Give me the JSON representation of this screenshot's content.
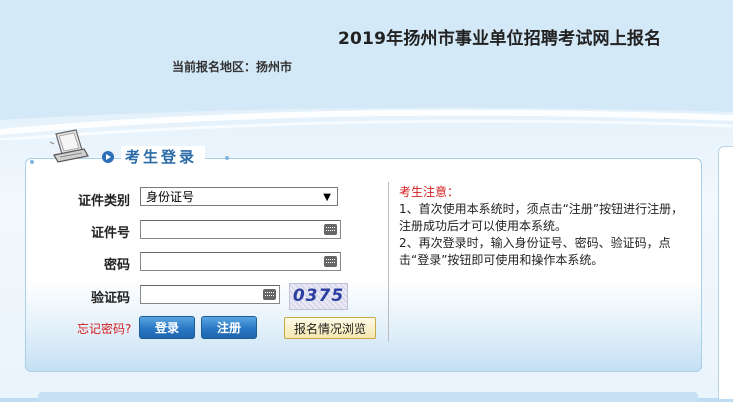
{
  "header": {
    "title": "2019年扬州市事业单位招聘考试网上报名",
    "region_label": "当前报名地区：扬州市"
  },
  "login": {
    "legend": "考生登录",
    "cert_type_label": "证件类别",
    "cert_type_value": "身份证号",
    "cert_no_label": "证件号",
    "password_label": "密码",
    "captcha_label": "验证码",
    "captcha_text": "0375",
    "forgot_label": "忘记密码?",
    "login_button": "登录",
    "register_button": "注册",
    "browse_button": "报名情况浏览"
  },
  "notes": {
    "title": "考生注意：",
    "line1": "1、首次使用本系统时，须点击“注册”按钮进行注册，注册成功后才可以使用本系统。",
    "line2": "2、再次登录时，输入身份证号、密码、验证码，点击“登录”按钮即可使用和操作本系统。"
  },
  "colors": {
    "accent": "#2a6aa6",
    "warning": "#d42020",
    "button_blue": "#2a78c4"
  }
}
